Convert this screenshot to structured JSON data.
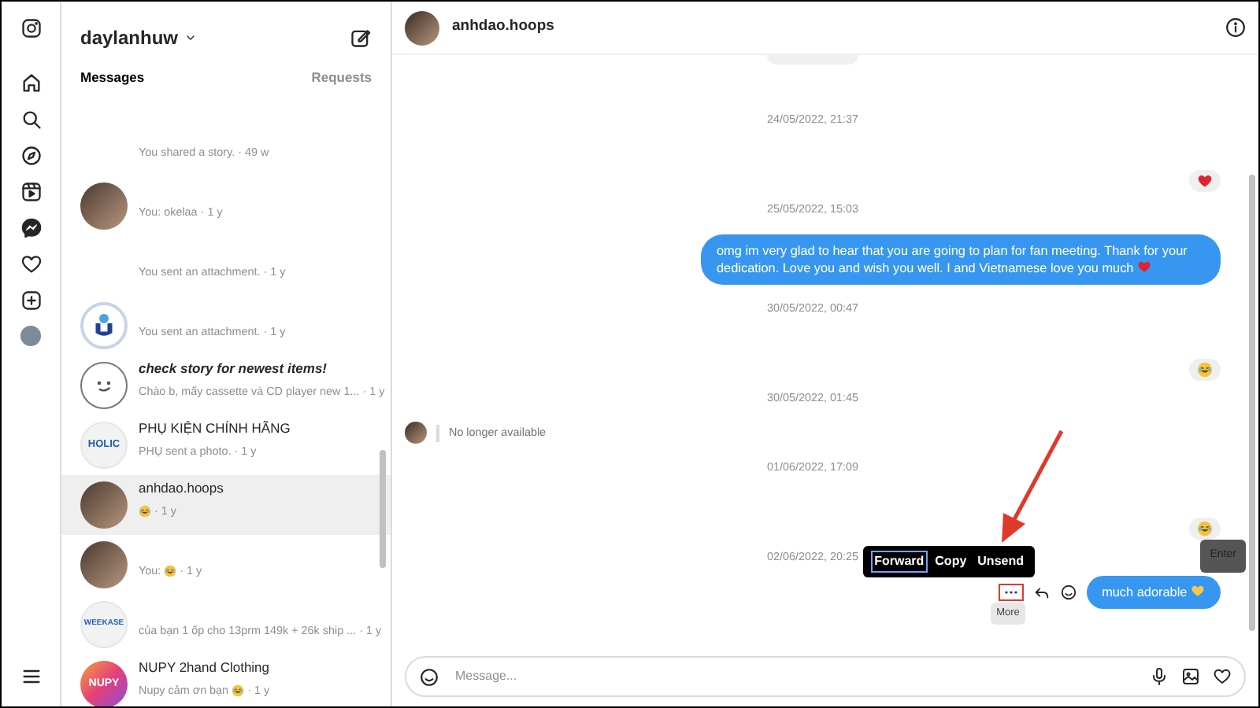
{
  "rail": [
    {
      "kind": "instagram"
    },
    {
      "kind": "home"
    },
    {
      "kind": "search"
    },
    {
      "kind": "explore"
    },
    {
      "kind": "reels"
    },
    {
      "kind": "messenger"
    },
    {
      "kind": "heart"
    },
    {
      "kind": "create"
    },
    {
      "kind": "avatar"
    },
    {
      "kind": "menu"
    }
  ],
  "account": {
    "username": "daylanhuw"
  },
  "tabs": [
    {
      "label": "Messages",
      "selected": true
    },
    {
      "label": "Requests",
      "selected": false
    }
  ],
  "conversations": [
    {
      "kind": "none",
      "preview": "You shared a story.",
      "time": "· 49 w",
      "selected": false
    },
    {
      "kind": "photo",
      "preview": "You: okelaa",
      "time": "· 1 y",
      "selected": false
    },
    {
      "kind": "none",
      "preview": "You sent an attachment.",
      "time": "· 1 y",
      "selected": false
    },
    {
      "kind": "logo",
      "preview": "You sent an attachment.",
      "time": "· 1 y",
      "selected": false
    },
    {
      "kind": "smiley",
      "name": "check story for newest items!",
      "name_italic": true,
      "preview": "Chào b, mấy cassette và CD player new 1...",
      "time": "· 1 y",
      "selected": false
    },
    {
      "kind": "text",
      "avatar_text": "HOLIC",
      "name": "PHỤ KIỆN CHÍNH HÃNG",
      "preview": "PHỤ sent a photo.",
      "time": "· 1 y",
      "selected": false
    },
    {
      "kind": "photo",
      "name": "anhdao.hoops",
      "emoji": true,
      "time": "· 1 y",
      "selected": true
    },
    {
      "kind": "photo",
      "preview": "You:",
      "emoji": true,
      "time": "· 1 y",
      "selected": false
    },
    {
      "kind": "text",
      "avatar_text": "WEEKASE",
      "preview": "của bạn 1 ốp cho 13prm 149k + 26k ship ...",
      "time": "· 1 y",
      "selected": false
    },
    {
      "kind": "gradient",
      "avatar_text": "NUPY",
      "name": "NUPY 2hand Clothing",
      "preview": "Nupy cảm ơn bạn",
      "emoji": true,
      "time": "· 1 y",
      "selected": false
    }
  ],
  "chat": {
    "title": "anhdao.hoops",
    "items": [
      {
        "kind": "timestamp",
        "text": "24/05/2022, 21:37"
      },
      {
        "kind": "heart-reaction"
      },
      {
        "kind": "timestamp",
        "text": "25/05/2022, 15:03"
      },
      {
        "kind": "text",
        "text": "omg im very glad to hear that you are going to plan for fan meeting. Thank for your dedication. Love you and wish you well. I and Vietnamese love you much",
        "color": "#e0242f"
      },
      {
        "kind": "timestamp",
        "text": "30/05/2022, 00:47"
      },
      {
        "kind": "laugh-reaction"
      },
      {
        "kind": "timestamp",
        "text": "30/05/2022, 01:45"
      },
      {
        "kind": "unavailable",
        "text": "No longer available"
      },
      {
        "kind": "timestamp",
        "text": "01/06/2022, 17:09"
      },
      {
        "kind": "laugh-reaction"
      },
      {
        "kind": "timestamp",
        "text": "02/06/2022, 20:25"
      },
      {
        "kind": "text",
        "text": "much adorable",
        "color": "#f7c948",
        "hovered": true
      }
    ],
    "menu": [
      {
        "label": "Forward",
        "selected": true
      },
      {
        "label": "Copy",
        "selected": false
      },
      {
        "label": "Unsend",
        "selected": false
      }
    ],
    "more_tooltip": "More",
    "enter_tooltip": "Enter",
    "input": {
      "placeholder": "Message..."
    }
  }
}
